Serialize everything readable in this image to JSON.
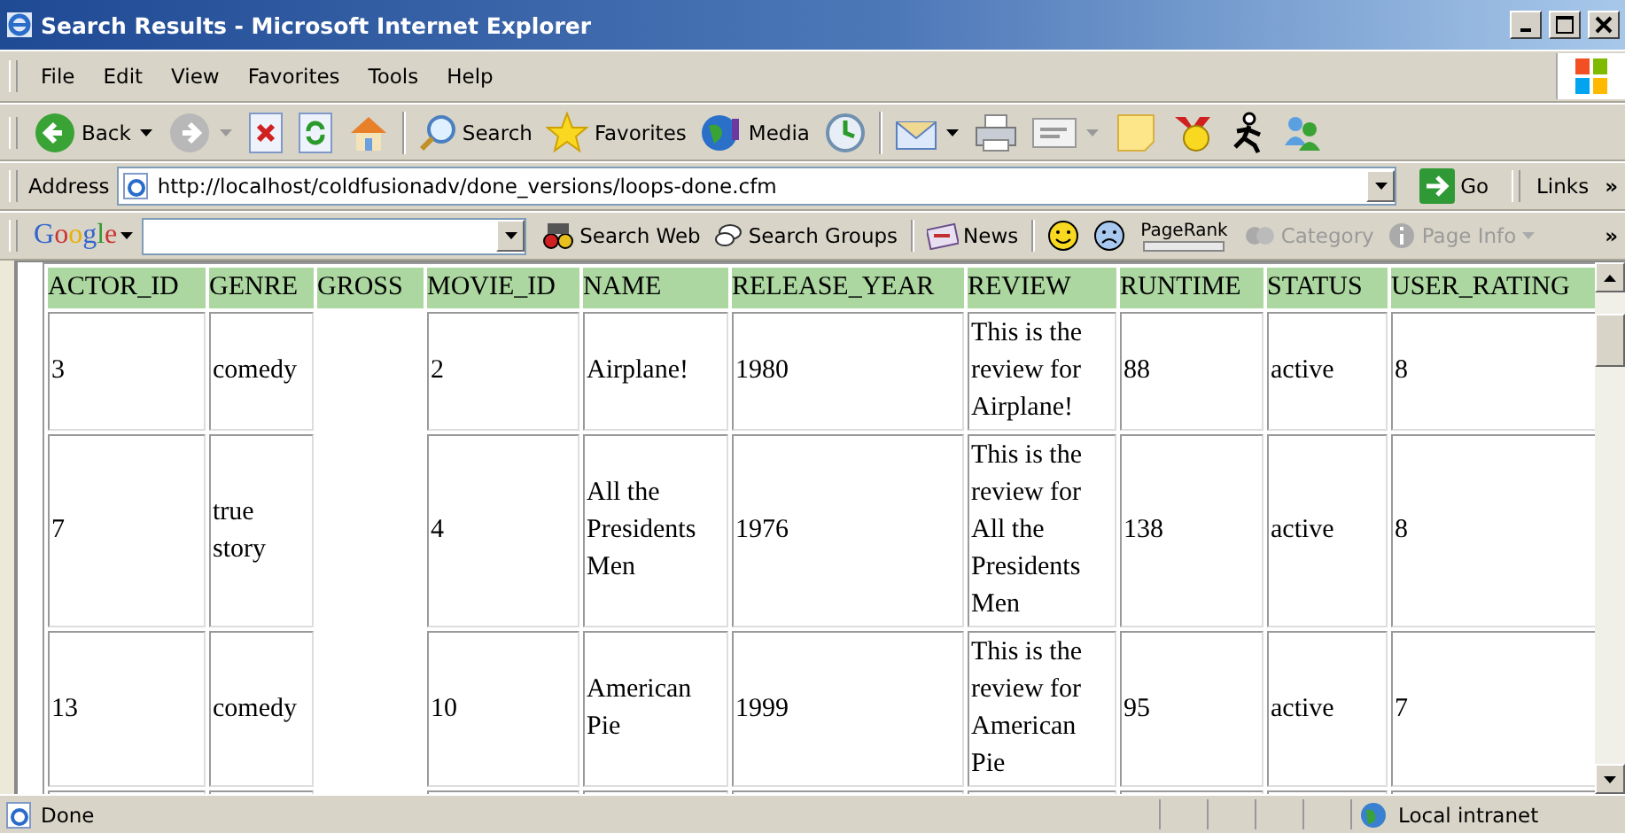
{
  "window": {
    "title": "Search Results - Microsoft Internet Explorer"
  },
  "menu": [
    "File",
    "Edit",
    "View",
    "Favorites",
    "Tools",
    "Help"
  ],
  "toolbar": {
    "back": "Back",
    "forward": {
      "disabled": true
    },
    "search": "Search",
    "favorites": "Favorites",
    "media": "Media"
  },
  "address_bar": {
    "label": "Address",
    "url": "http://localhost/coldfusionadv/done_versions/loops-done.cfm",
    "go": "Go",
    "links": "Links",
    "more": "»"
  },
  "google_bar": {
    "logo": "Google",
    "search_web": "Search Web",
    "search_groups": "Search Groups",
    "news": "News",
    "pagerank": "PageRank",
    "category": {
      "label": "Category",
      "disabled": true
    },
    "page_info": {
      "label": "Page Info",
      "disabled": true
    },
    "more": "»"
  },
  "table": {
    "columns": [
      "ACTOR_ID",
      "GENRE",
      "GROSS",
      "MOVIE_ID",
      "NAME",
      "RELEASE_YEAR",
      "REVIEW",
      "RUNTIME",
      "STATUS",
      "USER_RATING"
    ],
    "rows": [
      {
        "cells": [
          {
            "kind": "text",
            "text": "3"
          },
          {
            "kind": "text",
            "text": "comedy"
          },
          {
            "kind": "blank"
          },
          {
            "kind": "text",
            "text": "2"
          },
          {
            "kind": "text",
            "text": "Airplane!"
          },
          {
            "kind": "text",
            "text": "1980"
          },
          {
            "kind": "text",
            "text": "This is the review for Airplane!"
          },
          {
            "kind": "text",
            "text": "88"
          },
          {
            "kind": "text",
            "text": "active"
          },
          {
            "kind": "text",
            "text": "8"
          }
        ]
      },
      {
        "cells": [
          {
            "kind": "text",
            "text": "7"
          },
          {
            "kind": "text",
            "text": "true story"
          },
          {
            "kind": "blank"
          },
          {
            "kind": "text",
            "text": "4"
          },
          {
            "kind": "text",
            "text": "All the Presidents Men"
          },
          {
            "kind": "text",
            "text": "1976"
          },
          {
            "kind": "text",
            "text": "This is the review for All the Presidents Men"
          },
          {
            "kind": "text",
            "text": "138"
          },
          {
            "kind": "text",
            "text": "active"
          },
          {
            "kind": "text",
            "text": "8"
          }
        ]
      },
      {
        "cells": [
          {
            "kind": "text",
            "text": "13"
          },
          {
            "kind": "text",
            "text": "comedy"
          },
          {
            "kind": "blank"
          },
          {
            "kind": "text",
            "text": "10"
          },
          {
            "kind": "text",
            "text": "American Pie"
          },
          {
            "kind": "text",
            "text": "1999"
          },
          {
            "kind": "text",
            "text": "This is the review for American Pie"
          },
          {
            "kind": "text",
            "text": "95"
          },
          {
            "kind": "text",
            "text": "active"
          },
          {
            "kind": "text",
            "text": "7"
          }
        ]
      },
      {
        "cells": [
          {
            "kind": "cut"
          },
          {
            "kind": "cut"
          },
          {
            "kind": "blank"
          },
          {
            "kind": "cut"
          },
          {
            "kind": "cut"
          },
          {
            "kind": "cut"
          },
          {
            "kind": "cut"
          },
          {
            "kind": "cut"
          },
          {
            "kind": "cut"
          },
          {
            "kind": "cut"
          }
        ]
      }
    ]
  },
  "status_bar": {
    "text": "Done",
    "zone": "Local intranet"
  }
}
